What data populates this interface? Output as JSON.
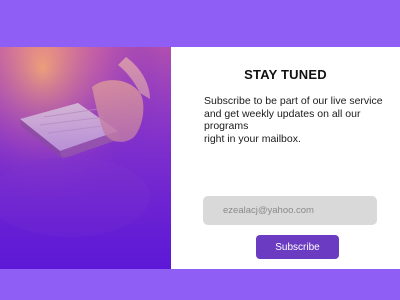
{
  "newsletter": {
    "title": "STAY TUNED",
    "description": "Subscribe to be part of our live service\nand get weekly updates on all our programs\nright in your mailbox.",
    "email_value": "ezealacj@yahoo.com",
    "subscribe_label": "Subscribe"
  },
  "colors": {
    "page_background": "#8f5ff5",
    "card_background": "#ffffff",
    "button_background": "#6b3cc2",
    "field_background": "#d9d9d9"
  },
  "hero": {
    "image_subject": "hands-on-open-book"
  }
}
